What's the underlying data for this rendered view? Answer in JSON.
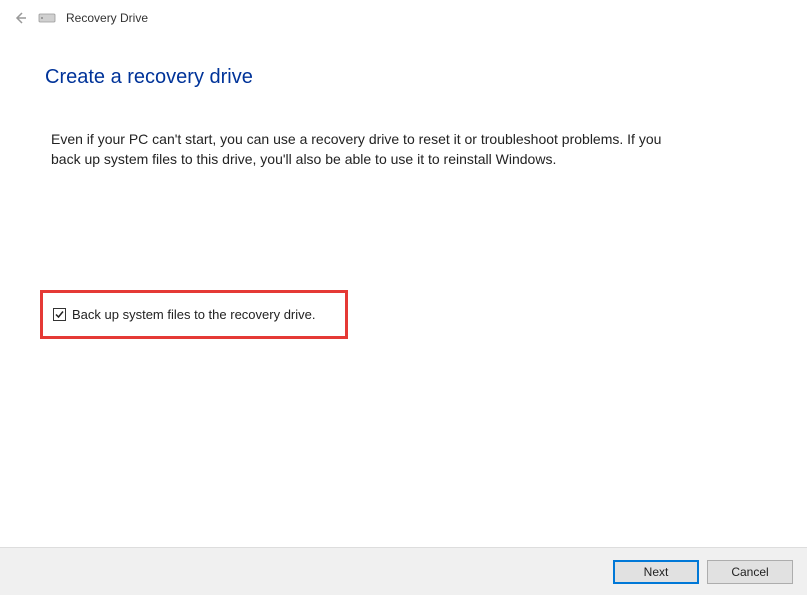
{
  "header": {
    "title": "Recovery Drive"
  },
  "page": {
    "title": "Create a recovery drive",
    "description": "Even if your PC can't start, you can use a recovery drive to reset it or troubleshoot problems. If you back up system files to this drive, you'll also be able to use it to reinstall Windows."
  },
  "checkbox": {
    "label": "Back up system files to the recovery drive.",
    "checked": true
  },
  "footer": {
    "next_label": "Next",
    "cancel_label": "Cancel"
  }
}
